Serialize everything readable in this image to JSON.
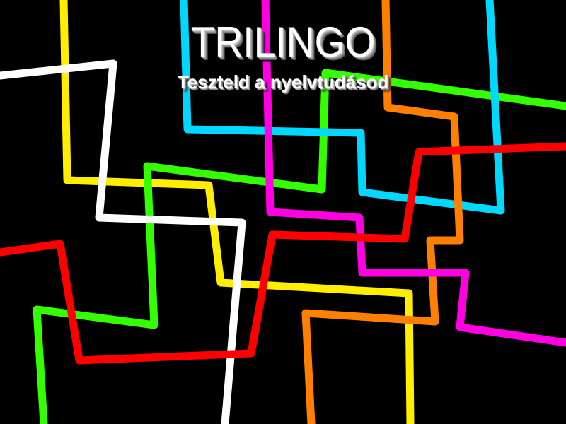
{
  "title": "TRILINGO",
  "subtitle": "Teszteld a nyelvtudásod",
  "colors": {
    "background": "#000000",
    "title": "#ffffff",
    "yellow": "#ffee00",
    "white": "#ffffff",
    "cyan": "#00d8ff",
    "orange": "#ff8000",
    "magenta": "#ff00e0",
    "green": "#33ff00",
    "red": "#ff0000"
  }
}
